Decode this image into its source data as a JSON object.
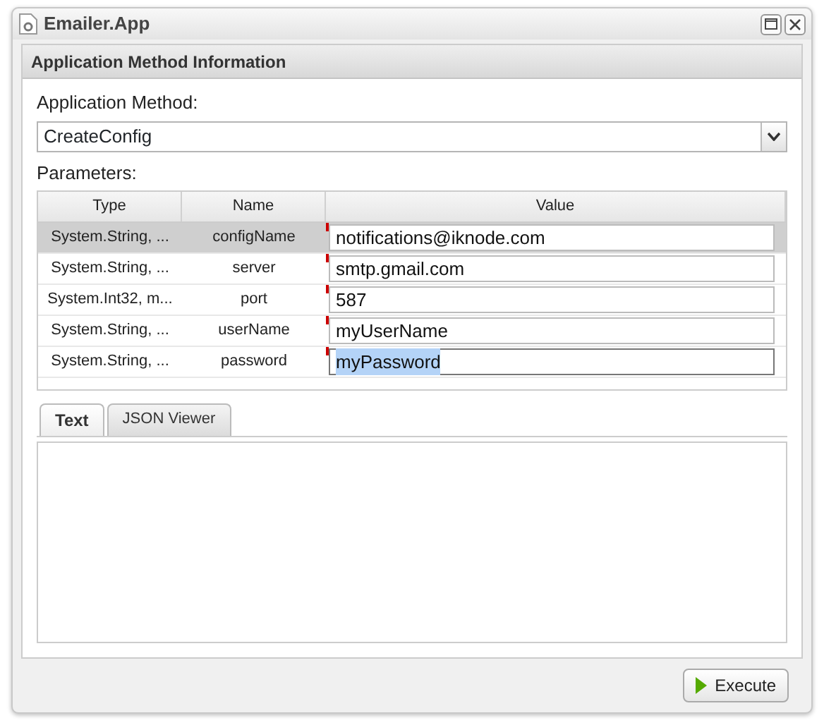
{
  "window": {
    "title": "Emailer.App"
  },
  "panel": {
    "title": "Application Method Information"
  },
  "method": {
    "label": "Application Method:",
    "value": "CreateConfig"
  },
  "parameters": {
    "label": "Parameters:",
    "columns": [
      "Type",
      "Name",
      "Value"
    ],
    "rows": [
      {
        "type": "System.String, ...",
        "name": "configName",
        "value": "notifications@iknode.com",
        "selected": true,
        "modified": true,
        "text_selected": false
      },
      {
        "type": "System.String, ...",
        "name": "server",
        "value": "smtp.gmail.com",
        "selected": false,
        "modified": true,
        "text_selected": false
      },
      {
        "type": "System.Int32, m...",
        "name": "port",
        "value": "587",
        "selected": false,
        "modified": true,
        "text_selected": false
      },
      {
        "type": "System.String, ...",
        "name": "userName",
        "value": "myUserName",
        "selected": false,
        "modified": true,
        "text_selected": false
      },
      {
        "type": "System.String, ...",
        "name": "password",
        "value": "myPassword",
        "selected": false,
        "modified": true,
        "text_selected": true
      }
    ]
  },
  "tabs": [
    {
      "label": "Text",
      "selected": true
    },
    {
      "label": "JSON Viewer",
      "selected": false
    }
  ],
  "buttons": [
    {
      "label": "Execute"
    }
  ]
}
